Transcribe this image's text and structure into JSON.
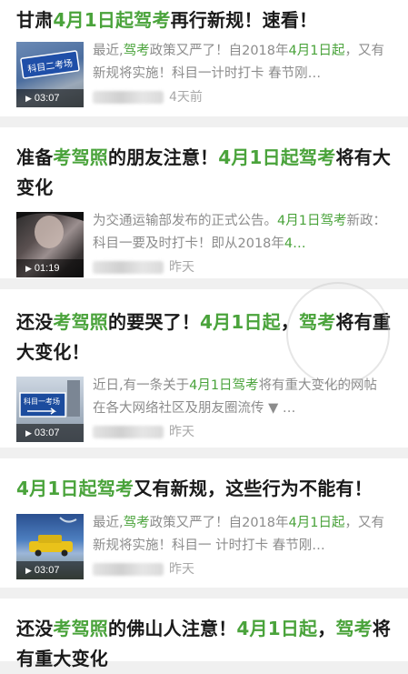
{
  "articles": [
    {
      "title": [
        {
          "t": "甘肃",
          "h": false
        },
        {
          "t": "4月1日起驾考",
          "h": true
        },
        {
          "t": "再行新规！速看！",
          "h": false
        }
      ],
      "snippet": [
        {
          "t": "最近,",
          "h": false
        },
        {
          "t": "驾考",
          "h": true
        },
        {
          "t": "政策又严了！自2018年",
          "h": false
        },
        {
          "t": "4月1日起",
          "h": true
        },
        {
          "t": "，又有新规将实施！科目一计时打卡 春节刚…",
          "h": false
        }
      ],
      "duration": "03:07",
      "time": "4天前",
      "thumb_caption": "科目二考场"
    },
    {
      "title": [
        {
          "t": "准备",
          "h": false
        },
        {
          "t": "考驾照",
          "h": true
        },
        {
          "t": "的朋友注意！",
          "h": false
        },
        {
          "t": "4月1日起驾考",
          "h": true
        },
        {
          "t": "将有大变化",
          "h": false
        }
      ],
      "snippet": [
        {
          "t": "为交通运输部发布的正式公告。",
          "h": false
        },
        {
          "t": "4月1日驾考",
          "h": true
        },
        {
          "t": "新政：科目一要及时打卡！即从2018年",
          "h": false
        },
        {
          "t": "4…",
          "h": true
        }
      ],
      "duration": "01:19",
      "time": "昨天",
      "thumb_caption": ""
    },
    {
      "title": [
        {
          "t": "还没",
          "h": false
        },
        {
          "t": "考驾照",
          "h": true
        },
        {
          "t": "的要哭了！",
          "h": false
        },
        {
          "t": "4月1日起",
          "h": true
        },
        {
          "t": "，",
          "h": false
        },
        {
          "t": "驾考",
          "h": true
        },
        {
          "t": "将有重大变化！",
          "h": false
        }
      ],
      "snippet": [
        {
          "t": "近日,有一条关于",
          "h": false
        },
        {
          "t": "4月1日驾考",
          "h": true
        },
        {
          "t": "将有重大变化的网帖 在各大网络社区及朋友圈流传 ▼ …",
          "h": false
        }
      ],
      "duration": "03:07",
      "time": "昨天",
      "thumb_caption": "科目一考场"
    },
    {
      "title": [
        {
          "t": "4月1日起驾考",
          "h": true
        },
        {
          "t": "又有新规，这些行为不能有！",
          "h": false
        }
      ],
      "snippet": [
        {
          "t": "最近,",
          "h": false
        },
        {
          "t": "驾考",
          "h": true
        },
        {
          "t": "政策又严了！自2018年",
          "h": false
        },
        {
          "t": "4月1日起",
          "h": true
        },
        {
          "t": "，又有新规将实施！科目一 计时打卡 春节刚…",
          "h": false
        }
      ],
      "duration": "03:07",
      "time": "昨天",
      "thumb_caption": ""
    },
    {
      "title": [
        {
          "t": "还没",
          "h": false
        },
        {
          "t": "考驾照",
          "h": true
        },
        {
          "t": "的佛山人注意！",
          "h": false
        },
        {
          "t": "4月1日起",
          "h": true
        },
        {
          "t": "，",
          "h": false
        },
        {
          "t": "驾考",
          "h": true
        },
        {
          "t": "将有重大变化",
          "h": false
        }
      ]
    }
  ],
  "colors": {
    "highlight": "#4aa33b",
    "background": "#f0f0f0",
    "meta": "#a8a8a8"
  },
  "icons": {
    "play": "play-icon"
  }
}
